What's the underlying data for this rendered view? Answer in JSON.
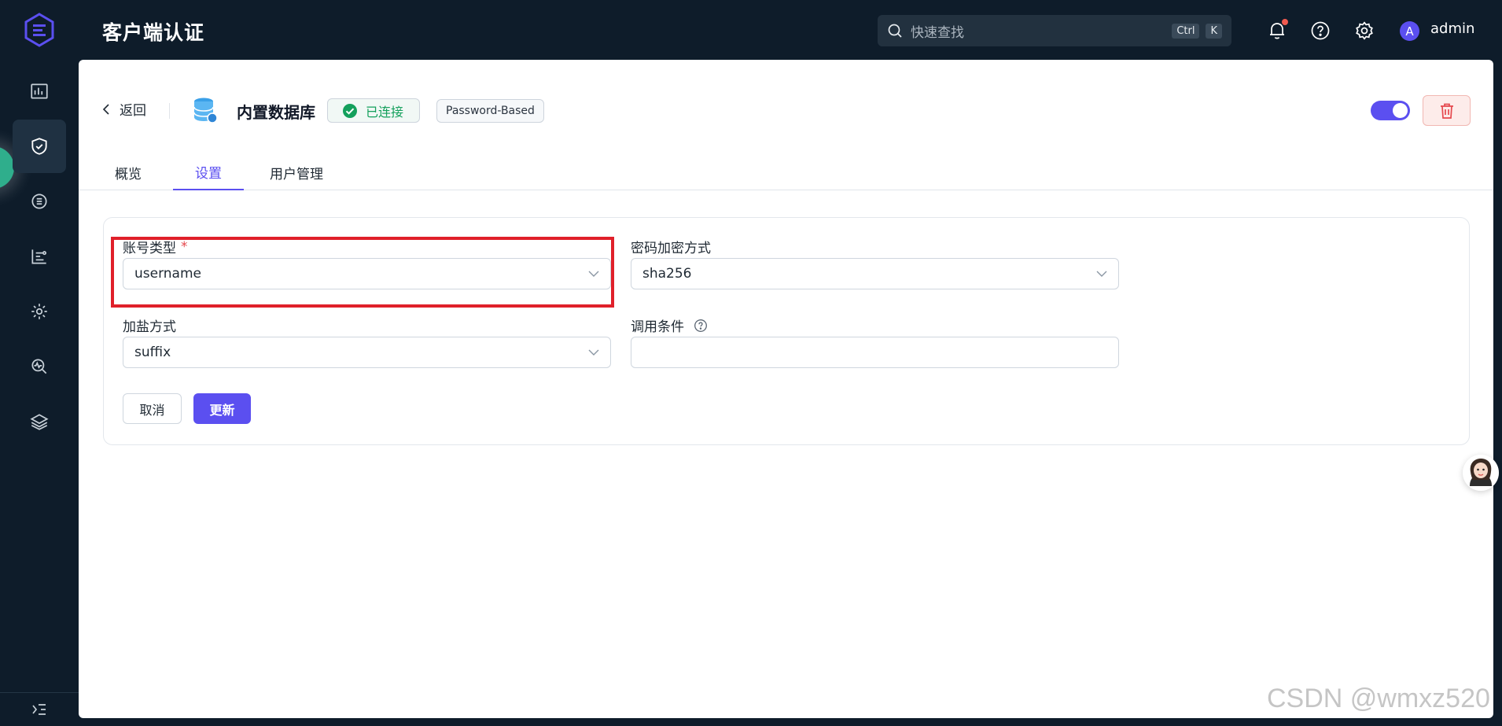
{
  "header": {
    "title": "客户端认证",
    "search_placeholder": "快速查找",
    "shortcut_ctrl": "Ctrl",
    "shortcut_k": "K",
    "avatar_letter": "A",
    "username": "admin"
  },
  "rail": {
    "items": [
      "dashboard",
      "access-control",
      "integration",
      "data-flow",
      "settings",
      "diagnose",
      "extensions"
    ],
    "active": "access-control"
  },
  "page": {
    "back_label": "返回",
    "db_title": "内置数据库",
    "status_label": "已连接",
    "mechanism_label": "Password-Based",
    "enabled": true
  },
  "tabs": [
    {
      "label": "概览",
      "active": false
    },
    {
      "label": "设置",
      "active": true
    },
    {
      "label": "用户管理",
      "active": false
    }
  ],
  "form": {
    "account_type": {
      "label": "账号类型",
      "required_mark": "*",
      "value": "username"
    },
    "password_hash": {
      "label": "密码加密方式",
      "value": "sha256"
    },
    "salt_position": {
      "label": "加盐方式",
      "value": "suffix"
    },
    "precondition": {
      "label": "调用条件",
      "value": ""
    },
    "cancel_label": "取消",
    "update_label": "更新"
  },
  "watermark": "CSDN @wmxz520",
  "colors": {
    "primary": "#5b4ff0",
    "sidebar_bg": "#0e1c2a",
    "success": "#14a05c",
    "danger": "#e5484d",
    "highlight_box": "#e0202a"
  }
}
